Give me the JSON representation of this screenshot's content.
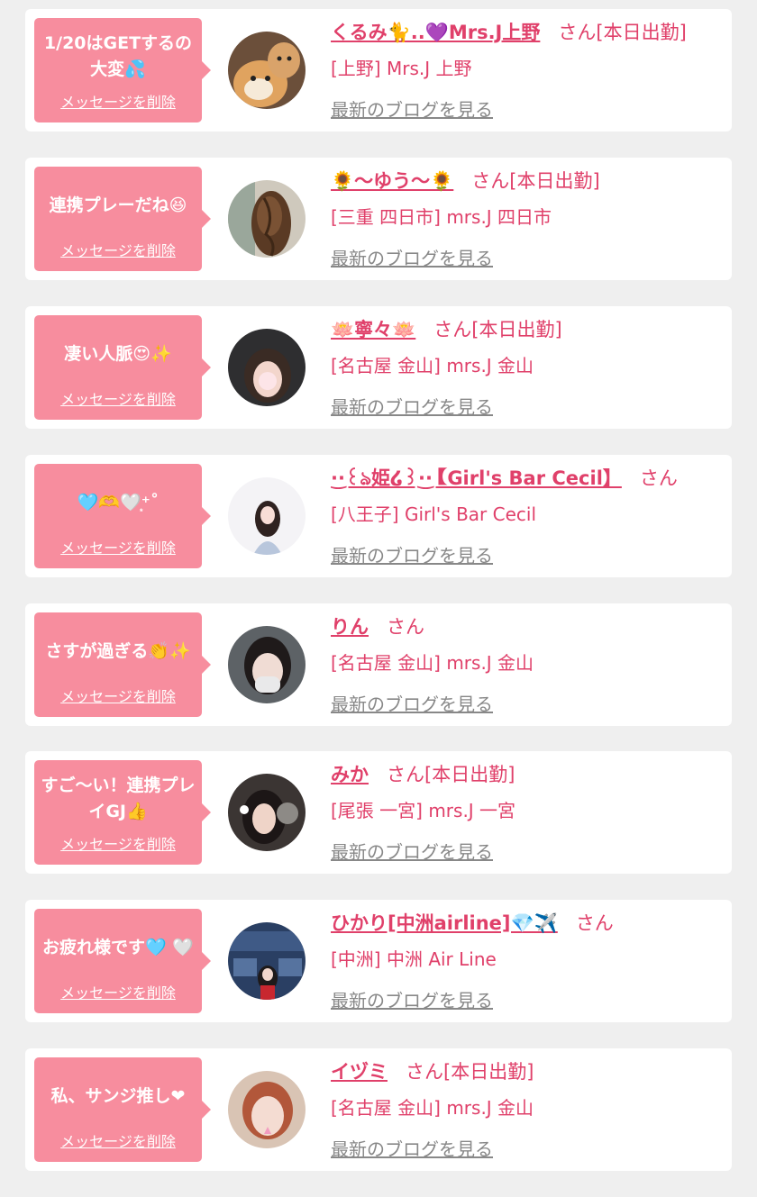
{
  "delete_label": "メッセージを削除",
  "blog_label": "最新のブログを見る",
  "colors": {
    "accent": "#e0406a",
    "bubble": "#f78d9e",
    "background": "#efefef",
    "link_gray": "#888888"
  },
  "items": [
    {
      "message": "1/20はGETするの大変💦",
      "name": "くるみ🐈..💜Mrs.J上野",
      "suffix": "さん[本日出勤]",
      "shop": "[上野] Mrs.J 上野",
      "has_blog": true,
      "avatar_icon": "dog-photo-avatar"
    },
    {
      "message": "連携プレーだね😆",
      "name": "🌻〜ゆう〜🌻",
      "suffix": "さん[本日出勤]",
      "shop": "[三重 四日市] mrs.J 四日市",
      "has_blog": true,
      "avatar_icon": "hair-photo-avatar"
    },
    {
      "message": "凄い人脈😍✨",
      "name": "🪷寧々🪷",
      "suffix": "さん[本日出勤]",
      "shop": "[名古屋 金山] mrs.J 金山",
      "has_blog": true,
      "avatar_icon": "portrait-photo-avatar"
    },
    {
      "message": "🩵🫶🤍͙⁺˚",
      "name": "·͜·꒰ঌ姫໒꒱·͜·【Girl's Bar Cecil】",
      "suffix": "さん",
      "shop": "[八王子] Girl's Bar Cecil",
      "has_blog": true,
      "avatar_icon": "portrait-photo-avatar"
    },
    {
      "message": "さすが過ぎる👏✨",
      "name": "りん",
      "suffix": "さん",
      "shop": "[名古屋 金山] mrs.J 金山",
      "has_blog": true,
      "avatar_icon": "portrait-photo-avatar"
    },
    {
      "message": "すご〜い！連携プレイGJ👍",
      "name": "みか",
      "suffix": "さん[本日出勤]",
      "shop": "[尾張 一宮] mrs.J 一宮",
      "has_blog": true,
      "avatar_icon": "portrait-photo-avatar"
    },
    {
      "message": "お疲れ様です🩵 🤍",
      "name": "ひかり[中洲airline]💎✈️",
      "suffix": "さん",
      "shop": "[中洲] 中洲 Air Line",
      "has_blog": true,
      "avatar_icon": "airline-photo-avatar"
    },
    {
      "message": "私、サンジ推し❤︎",
      "name": "イヅミ",
      "suffix": "さん[本日出勤]",
      "shop": "[名古屋 金山] mrs.J 金山",
      "has_blog": true,
      "avatar_icon": "portrait-photo-avatar"
    }
  ]
}
